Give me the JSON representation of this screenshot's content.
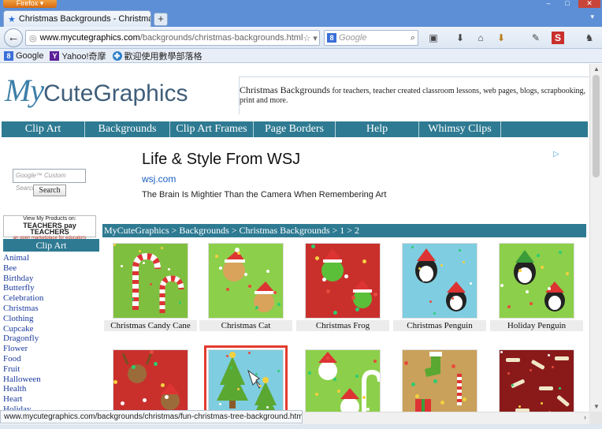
{
  "browser": {
    "app_button": "Firefox",
    "tab_title": "Christmas Backgrounds - Christmas B...",
    "url_host": "www.mycutegraphics.com",
    "url_path": "/backgrounds/christmas-backgrounds.html",
    "search_placeholder": "Google",
    "bookmarks": [
      {
        "label": "Google",
        "icon": "google-icon",
        "color": "#3b6fd8"
      },
      {
        "label": "Yahoo!奇摩",
        "icon": "yahoo-icon",
        "color": "#5c1f99"
      },
      {
        "label": "歡迎使用數學部落格",
        "icon": "math-blog-icon",
        "color": "#2f80c9"
      }
    ],
    "status_url": "www.mycutegraphics.com/backgrounds/christmas/fun-christmas-tree-background.html"
  },
  "site": {
    "logo_my": "My",
    "logo_rest": "CuteGraphics",
    "header_heading": "Christmas Backgrounds",
    "header_text": " for teachers, teacher created classroom lessons, web pages, blogs, scrapbooking, print and more.",
    "nav": [
      "Clip Art",
      "Backgrounds",
      "Clip Art Frames",
      "Page Borders",
      "Help",
      "Whimsy Clips"
    ]
  },
  "ad": {
    "title": "Life & Style From WSJ",
    "url": "wsj.com",
    "text": "The Brain Is Mightier Than the Camera When Remembering Art"
  },
  "sidebar": {
    "search_placeholder": "Google™ Custom Search",
    "search_button": "Search",
    "badge_line1": "View My Products on:",
    "badge_line2": "TEACHERS pay TEACHERS",
    "badge_line3": "an open marketplace for educators",
    "clipart_heading": "Clip Art",
    "categories": [
      "Animal",
      "Bee",
      "Birthday",
      "Butterfly",
      "Celebration",
      "Christmas",
      "Clothing",
      "Cupcake",
      "Dragonfly",
      "Flower",
      "Food",
      "Fruit",
      "Halloween",
      "Health",
      "Heart",
      "Holiday"
    ]
  },
  "breadcrumb": "MyCuteGraphics > Backgrounds > Christmas Backgrounds > 1 > 2",
  "tiles_row1": [
    {
      "caption": "Christmas Candy Cane",
      "bg": "#7fbf3f"
    },
    {
      "caption": "Christmas Cat",
      "bg": "#8ccf4a"
    },
    {
      "caption": "Christmas Frog",
      "bg": "#c9302c"
    },
    {
      "caption": "Christmas Penguin",
      "bg": "#7fcde0"
    },
    {
      "caption": "Holiday Penguin",
      "bg": "#8ccf4a"
    }
  ],
  "tiles_row2": [
    {
      "caption": "",
      "bg": "#c9302c"
    },
    {
      "caption": "",
      "bg": "#7fcde0"
    },
    {
      "caption": "",
      "bg": "#8ccf4a"
    },
    {
      "caption": "",
      "bg": "#c9a15a"
    },
    {
      "caption": "",
      "bg": "#8a1a1a"
    }
  ]
}
